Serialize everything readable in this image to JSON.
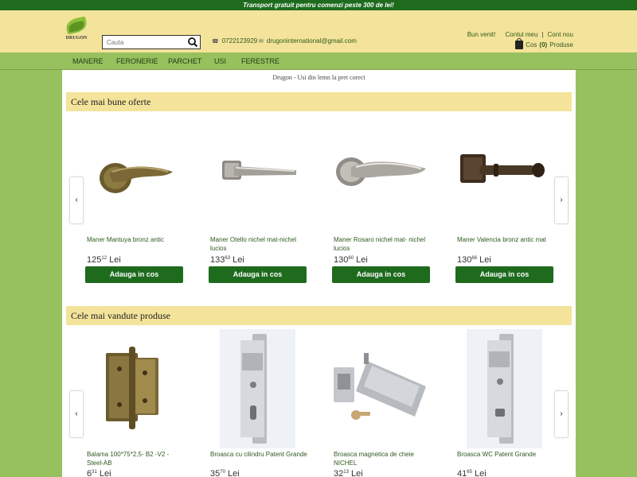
{
  "topbar": {
    "text": "Transport gratuit pentru comenzi peste 300 de lei!"
  },
  "logo": {
    "text": "DRUGON"
  },
  "search": {
    "placeholder": "Cauta"
  },
  "contact": {
    "phone": "0722123929",
    "email": "drugoninternational@gmail.com"
  },
  "account": {
    "welcome": "Bun venit!",
    "my_account": "Contul meu",
    "new_account": "Cont nou",
    "cart_label": "Cos",
    "cart_count": "(0)",
    "cart_suffix": "Produse"
  },
  "nav": {
    "items": [
      "MANERE",
      "FERONERIE",
      "PARCHET",
      "USI",
      "FERESTRE"
    ]
  },
  "tagline": "Drugon - Usi din lemn la pret corect",
  "sections": [
    {
      "title": "Cele mai bune oferte",
      "products": [
        {
          "name": "Maner Mantuya bronz antic",
          "price_int": "125",
          "price_dec": "12",
          "currency": "Lei",
          "button": "Adauga in cos",
          "image": "bronze-lever-handle"
        },
        {
          "name": "Maner Otello nichel mat-nichel lucios",
          "price_int": "133",
          "price_dec": "63",
          "currency": "Lei",
          "button": "Adauga in cos",
          "image": "nickel-square-rose-handle"
        },
        {
          "name": "Maner Rosaro nichel mat- nichel lucios",
          "price_int": "130",
          "price_dec": "60",
          "currency": "Lei",
          "button": "Adauga in cos",
          "image": "nickel-round-rose-handle"
        },
        {
          "name": "Maner Valencia bronz antic mat",
          "price_int": "130",
          "price_dec": "66",
          "currency": "Lei",
          "button": "Adauga in cos",
          "image": "dark-bronze-square-handle"
        }
      ]
    },
    {
      "title": "Cele mai vandute produse",
      "products": [
        {
          "name": "Balama 100*75*2,5- B2 -V2 - Steel-AB",
          "price_int": "6",
          "price_dec": "31",
          "currency": "Lei",
          "image": "brass-hinge"
        },
        {
          "name": "Broasca cu cilindru Patent Grande",
          "price_int": "35",
          "price_dec": "70",
          "currency": "Lei",
          "image": "cylinder-lock"
        },
        {
          "name": "Broasca magnetica de cheie NICHEL",
          "price_int": "32",
          "price_dec": "13",
          "currency": "Lei",
          "image": "magnetic-key-lock"
        },
        {
          "name": "Broasca WC Patent Grande",
          "price_int": "41",
          "price_dec": "65",
          "currency": "Lei",
          "image": "wc-lock"
        }
      ]
    }
  ],
  "colors": {
    "green_dark": "#1e6b1e",
    "green_light": "#97c05f",
    "yellow": "#f4e39a"
  }
}
